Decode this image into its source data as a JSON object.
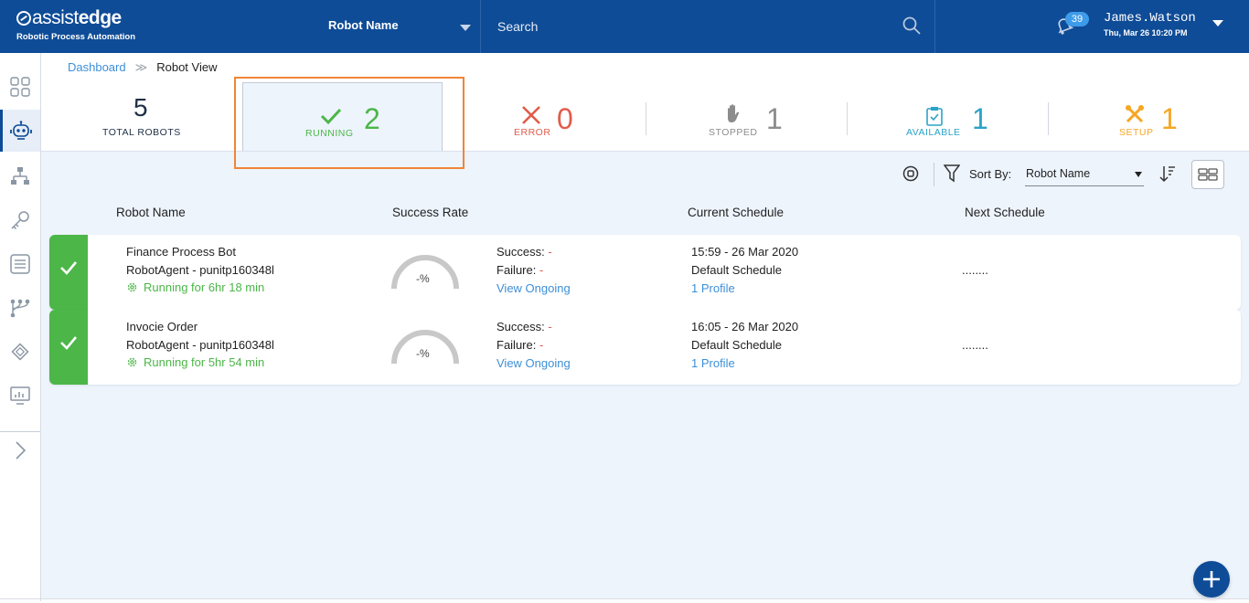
{
  "header": {
    "logo_main_a": "assist",
    "logo_main_b": "edge",
    "logo_sub": "Robotic Process Automation",
    "robot_select_label": "Robot Name",
    "search_placeholder": "Search",
    "notification_count": "39",
    "user_name": "James.Watson",
    "user_date": "Thu, Mar 26 10:20 PM"
  },
  "sidebar": {
    "items": [
      {
        "icon": "grid-icon"
      },
      {
        "icon": "robot-icon",
        "active": true
      },
      {
        "icon": "hierarchy-icon"
      },
      {
        "icon": "key-icon"
      },
      {
        "icon": "list-icon"
      },
      {
        "icon": "workflow-icon"
      },
      {
        "icon": "chip-icon"
      },
      {
        "icon": "monitor-chart-icon"
      },
      {
        "icon": "chevron-right-icon"
      }
    ]
  },
  "breadcrumb": {
    "parent": "Dashboard",
    "separator": "≫",
    "current": "Robot View"
  },
  "stats": {
    "total": {
      "value": "5",
      "label": "TOTAL ROBOTS"
    },
    "running": {
      "value": "2",
      "label": "RUNNING",
      "color": "#4cb648"
    },
    "error": {
      "value": "0",
      "label": "ERROR",
      "color": "#e05c4b"
    },
    "stopped": {
      "value": "1",
      "label": "STOPPED",
      "color": "#8c8c8c"
    },
    "available": {
      "value": "1",
      "label": "AVAILABLE",
      "color": "#2ba3c9"
    },
    "setup": {
      "value": "1",
      "label": "SETUP",
      "color": "#f5a623"
    }
  },
  "toolbar": {
    "sort_by_label": "Sort By:",
    "sort_value": "Robot Name"
  },
  "table": {
    "headers": [
      "Robot Name",
      "Success Rate",
      "Current Schedule",
      "Next Schedule"
    ],
    "rows": [
      {
        "name": "Finance Process Bot",
        "agent": "RobotAgent - punitp160348l",
        "running": "Running for 6hr 18 min",
        "gauge": "-%",
        "success_label": "Success:",
        "success_value": "-",
        "failure_label": "Failure:",
        "failure_value": "-",
        "ongoing": "View Ongoing",
        "schedule_time": "15:59 - 26 Mar 2020",
        "schedule_name": "Default Schedule",
        "profile": "1 Profile",
        "next": "........"
      },
      {
        "name": "Invocie Order",
        "agent": "RobotAgent - punitp160348l",
        "running": "Running for 5hr 54 min",
        "gauge": "-%",
        "success_label": "Success:",
        "success_value": "-",
        "failure_label": "Failure:",
        "failure_value": "-",
        "ongoing": "View Ongoing",
        "schedule_time": "16:05 - 26 Mar 2020",
        "schedule_name": "Default Schedule",
        "profile": "1 Profile",
        "next": "........"
      }
    ]
  },
  "colors": {
    "brand": "#0f4c97",
    "running_green": "#4cb648",
    "highlight": "#f08537"
  }
}
